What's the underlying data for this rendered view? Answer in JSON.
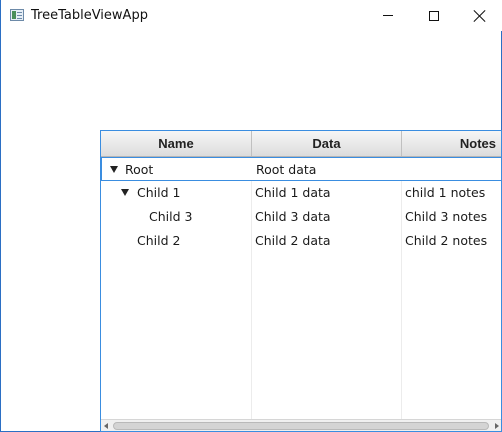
{
  "window": {
    "title": "TreeTableViewApp",
    "icon": "app-window-icon",
    "controls": [
      "minimize",
      "maximize",
      "close"
    ]
  },
  "table": {
    "columns": [
      "Name",
      "Data",
      "Notes"
    ],
    "rows": [
      {
        "name": "Root",
        "data": "Root data",
        "notes": "",
        "expanded": true,
        "selected": true,
        "depth": 0
      },
      {
        "name": "Child 1",
        "data": "Child 1 data",
        "notes": "child  1 notes",
        "expanded": true,
        "selected": false,
        "depth": 1
      },
      {
        "name": "Child 3",
        "data": "Child 3 data",
        "notes": "Child 3 notes",
        "expanded": false,
        "selected": false,
        "depth": 2
      },
      {
        "name": "Child 2",
        "data": "Child 2 data",
        "notes": "Child 2 notes",
        "expanded": false,
        "selected": false,
        "depth": 1
      }
    ]
  },
  "colors": {
    "accent": "#3a8de0",
    "header_top": "#f6f6f6",
    "header_bottom": "#dcdcdc"
  }
}
